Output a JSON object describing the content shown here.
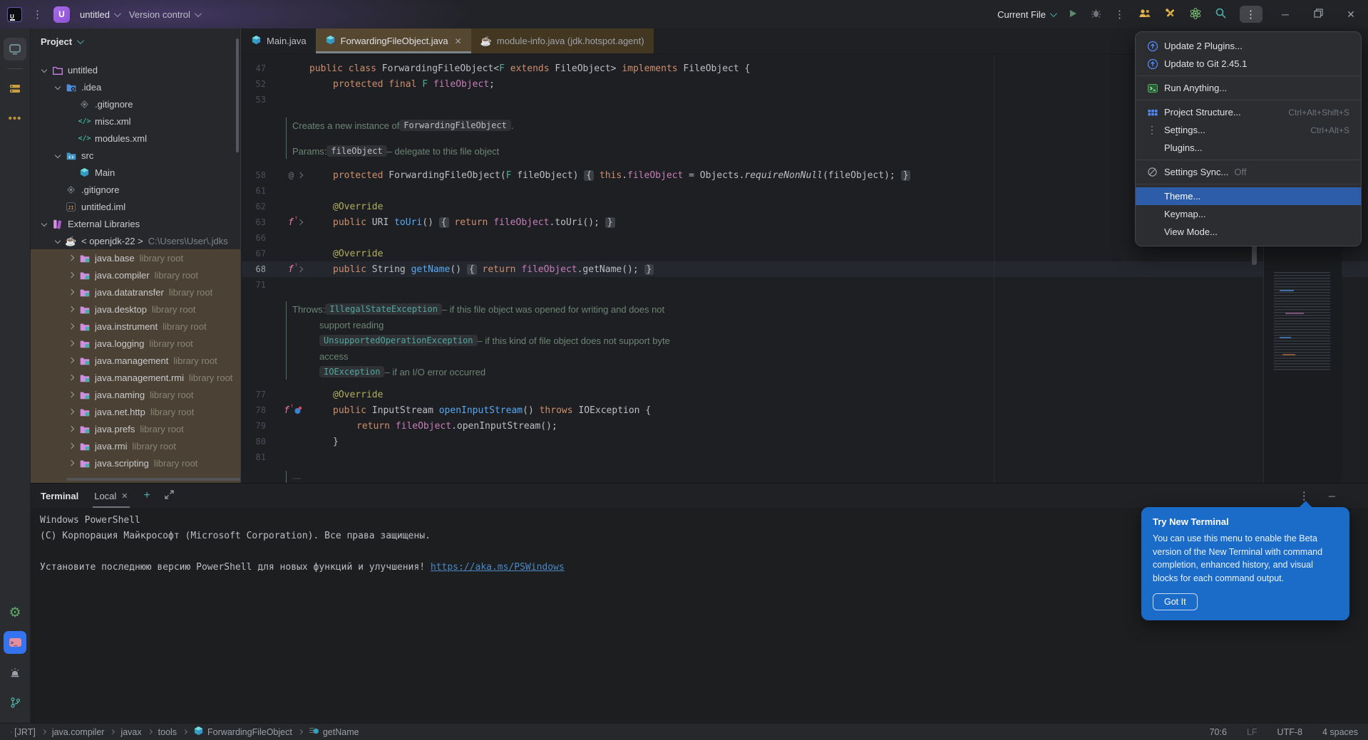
{
  "title_bar": {
    "project_name": "untitled",
    "vcs_widget": "Version control",
    "run_widget": "Current File"
  },
  "project_panel": {
    "header": "Project",
    "tree": [
      {
        "label": "untitled",
        "icon": "folderP",
        "lvl": 0,
        "ch": "v"
      },
      {
        "label": ".idea",
        "icon": "folderIdea",
        "lvl": 1,
        "ch": "v"
      },
      {
        "label": ".gitignore",
        "icon": "gitf",
        "lvl": 2
      },
      {
        "label": "misc.xml",
        "icon": "xml",
        "lvl": 2
      },
      {
        "label": "modules.xml",
        "icon": "xml",
        "lvl": 2
      },
      {
        "label": "src",
        "icon": "folderSrc",
        "lvl": 1,
        "ch": "v"
      },
      {
        "label": "Main",
        "icon": "cls",
        "lvl": 2
      },
      {
        "label": ".gitignore",
        "icon": "gitf",
        "lvl": 1
      },
      {
        "label": "untitled.iml",
        "icon": "iml",
        "lvl": 1
      },
      {
        "label": "External Libraries",
        "icon": "lib",
        "lvl": 0,
        "ch": "v"
      },
      {
        "label": "< openjdk-22 >",
        "meta": "C:\\Users\\User\\.jdks",
        "icon": "cup",
        "lvl": 1,
        "ch": "v"
      },
      {
        "label": "java.base",
        "meta": "library root",
        "icon": "modf",
        "lvl": 2,
        "ch": "r",
        "lib": 1
      },
      {
        "label": "java.compiler",
        "meta": "library root",
        "icon": "modf",
        "lvl": 2,
        "ch": "r",
        "lib": 1
      },
      {
        "label": "java.datatransfer",
        "meta": "library root",
        "icon": "modf",
        "lvl": 2,
        "ch": "r",
        "lib": 1
      },
      {
        "label": "java.desktop",
        "meta": "library root",
        "icon": "modf",
        "lvl": 2,
        "ch": "r",
        "lib": 1
      },
      {
        "label": "java.instrument",
        "meta": "library root",
        "icon": "modf",
        "lvl": 2,
        "ch": "r",
        "lib": 1
      },
      {
        "label": "java.logging",
        "meta": "library root",
        "icon": "modf",
        "lvl": 2,
        "ch": "r",
        "lib": 1
      },
      {
        "label": "java.management",
        "meta": "library root",
        "icon": "modf",
        "lvl": 2,
        "ch": "r",
        "lib": 1
      },
      {
        "label": "java.management.rmi",
        "meta": "library root",
        "icon": "modf",
        "lvl": 2,
        "ch": "r",
        "lib": 1
      },
      {
        "label": "java.naming",
        "meta": "library root",
        "icon": "modf",
        "lvl": 2,
        "ch": "r",
        "lib": 1
      },
      {
        "label": "java.net.http",
        "meta": "library root",
        "icon": "modf",
        "lvl": 2,
        "ch": "r",
        "lib": 1
      },
      {
        "label": "java.prefs",
        "meta": "library root",
        "icon": "modf",
        "lvl": 2,
        "ch": "r",
        "lib": 1
      },
      {
        "label": "java.rmi",
        "meta": "library root",
        "icon": "modf",
        "lvl": 2,
        "ch": "r",
        "lib": 1
      },
      {
        "label": "java.scripting",
        "meta": "library root",
        "icon": "modf",
        "lvl": 2,
        "ch": "r",
        "lib": 1
      }
    ]
  },
  "editor": {
    "tabs": [
      {
        "label": "Main.java",
        "icon": "cls"
      },
      {
        "label": "ForwardingFileObject.java",
        "icon": "cls",
        "active": 1,
        "close": 1
      },
      {
        "label": "module-info.java (jdk.hotspot.agent)",
        "icon": "cup",
        "warm": 1
      }
    ],
    "rows": [
      {
        "t": "c",
        "n": "47",
        "i": 0,
        "segs": [
          [
            "kw",
            "public class "
          ],
          [
            "pln",
            "ForwardingFileObject<"
          ],
          [
            "tp",
            "F"
          ],
          [
            "kw",
            " extends "
          ],
          [
            "pln",
            "FileObject> "
          ],
          [
            "kw",
            "implements "
          ],
          [
            "pln",
            "FileObject {"
          ]
        ]
      },
      {
        "t": "c",
        "n": "52",
        "i": 1,
        "segs": [
          [
            "kw",
            "protected final "
          ],
          [
            "tp",
            "F"
          ],
          [
            "pln",
            " "
          ],
          [
            "fld",
            "fileObject"
          ],
          [
            "pln",
            ";"
          ]
        ]
      },
      {
        "t": "c",
        "n": "53",
        "segs": []
      },
      {
        "t": "s",
        "h": 14
      },
      {
        "t": "d",
        "dl": 1,
        "segs": [
          [
            "doc",
            "Creates a new instance of "
          ],
          [
            "chip",
            "ForwardingFileObject"
          ],
          [
            "doc",
            " ."
          ]
        ]
      },
      {
        "t": "s",
        "h": 14,
        "dl": 1
      },
      {
        "t": "d",
        "dl": 1,
        "segs": [
          [
            "doc",
            "Params:  "
          ],
          [
            "chip",
            "fileObject"
          ],
          [
            "doc",
            "  – delegate to this file object"
          ]
        ]
      },
      {
        "t": "s",
        "h": 12
      },
      {
        "t": "c",
        "n": "58",
        "g": [
          "at",
          "fold"
        ],
        "i": 1,
        "segs": [
          [
            "kw",
            "protected "
          ],
          [
            "pln",
            "ForwardingFileObject("
          ],
          [
            "tp",
            "F"
          ],
          [
            "pln",
            " fileObject) "
          ],
          [
            "foldb",
            "{"
          ],
          [
            "pln",
            " "
          ],
          [
            "kw",
            "this"
          ],
          [
            "pln",
            "."
          ],
          [
            "fld",
            "fileObject"
          ],
          [
            "pln",
            " = Objects."
          ],
          [
            "itm",
            "requireNonNull"
          ],
          [
            "pln",
            "(fileObject); "
          ],
          [
            "foldb",
            "}"
          ]
        ]
      },
      {
        "t": "c",
        "n": "61",
        "segs": []
      },
      {
        "t": "c",
        "n": "62",
        "i": 1,
        "segs": [
          [
            "ann",
            "@Override"
          ]
        ]
      },
      {
        "t": "c",
        "n": "63",
        "g": [
          "fx",
          "fold"
        ],
        "i": 1,
        "segs": [
          [
            "kw",
            "public "
          ],
          [
            "pln",
            "URI "
          ],
          [
            "mth",
            "toUri"
          ],
          [
            "pln",
            "() "
          ],
          [
            "foldb",
            "{"
          ],
          [
            "kw",
            " return "
          ],
          [
            "fld",
            "fileObject"
          ],
          [
            "pln",
            ".toUri(); "
          ],
          [
            "foldb",
            "}"
          ]
        ]
      },
      {
        "t": "c",
        "n": "66",
        "segs": []
      },
      {
        "t": "c",
        "n": "67",
        "i": 1,
        "segs": [
          [
            "ann",
            "@Override"
          ]
        ]
      },
      {
        "t": "c",
        "n": "68",
        "hl": 1,
        "g": [
          "fx",
          "fold"
        ],
        "i": 1,
        "segs": [
          [
            "kw",
            "public "
          ],
          [
            "pln",
            "String "
          ],
          [
            "mth",
            "getName"
          ],
          [
            "pln",
            "() "
          ],
          [
            "foldb",
            "{"
          ],
          [
            "kw",
            " return "
          ],
          [
            "fld",
            "fileObject"
          ],
          [
            "pln",
            ".getName(); "
          ],
          [
            "foldb",
            "}"
          ]
        ]
      },
      {
        "t": "c",
        "n": "71",
        "segs": []
      },
      {
        "t": "s",
        "h": 12
      },
      {
        "t": "d",
        "dl": 1,
        "segs": [
          [
            "doc",
            "Throws:  "
          ],
          [
            "chipt",
            "IllegalStateException"
          ],
          [
            "doc",
            "  – if this file object was opened for writing and does not"
          ]
        ]
      },
      {
        "t": "d",
        "dl": 1,
        "di": 1,
        "segs": [
          [
            "doc",
            "support reading"
          ]
        ]
      },
      {
        "t": "d",
        "dl": 1,
        "di": 1,
        "segs": [
          [
            "chipt",
            "UnsupportedOperationException"
          ],
          [
            "doc",
            "  – if this kind of file object does not support byte"
          ]
        ]
      },
      {
        "t": "d",
        "dl": 1,
        "di": 1,
        "segs": [
          [
            "doc",
            "access"
          ]
        ]
      },
      {
        "t": "d",
        "dl": 1,
        "di": 1,
        "segs": [
          [
            "chipt",
            "IOException"
          ],
          [
            "doc",
            "  – if an I/O error occurred"
          ]
        ]
      },
      {
        "t": "s",
        "h": 10
      },
      {
        "t": "c",
        "n": "77",
        "i": 1,
        "segs": [
          [
            "ann",
            "@Override"
          ]
        ]
      },
      {
        "t": "c",
        "n": "78",
        "g": [
          "fx",
          "impl"
        ],
        "i": 1,
        "segs": [
          [
            "kw",
            "public "
          ],
          [
            "pln",
            "InputStream "
          ],
          [
            "mth",
            "openInputStream"
          ],
          [
            "pln",
            "() "
          ],
          [
            "kw",
            "throws"
          ],
          [
            "pln",
            " IOException {"
          ]
        ]
      },
      {
        "t": "c",
        "n": "79",
        "i": 2,
        "segs": [
          [
            "kw",
            "return "
          ],
          [
            "fld",
            "fileObject"
          ],
          [
            "pln",
            ".openInputStream();"
          ]
        ]
      },
      {
        "t": "c",
        "n": "80",
        "i": 1,
        "segs": [
          [
            "pln",
            "}"
          ]
        ]
      },
      {
        "t": "c",
        "n": "81",
        "segs": []
      },
      {
        "t": "s",
        "h": 8
      },
      {
        "t": "d",
        "dl": 1,
        "segs": [
          [
            "chip",
            "   "
          ]
        ]
      }
    ]
  },
  "menu": {
    "items": [
      {
        "icon": "upd",
        "label": "Update 2 Plugins..."
      },
      {
        "icon": "upd",
        "label": "Update to Git 2.45.1"
      },
      {
        "div": 1
      },
      {
        "icon": "runa",
        "label": "Run Anything..."
      },
      {
        "div": 1
      },
      {
        "icon": "pstruct",
        "label": "Project Structure...",
        "shortcut": "Ctrl+Alt+Shift+S"
      },
      {
        "icon": "kebab",
        "label": "Settings...",
        "mnemonic": "t",
        "shortcut": "Ctrl+Alt+S"
      },
      {
        "label": "Plugins..."
      },
      {
        "div": 1
      },
      {
        "icon": "synco",
        "label": "Settings Sync...",
        "suffix": "Off"
      },
      {
        "div": 1
      },
      {
        "label": "Theme...",
        "selected": 1
      },
      {
        "label": "Keymap..."
      },
      {
        "label": "View Mode..."
      }
    ]
  },
  "terminal": {
    "title": "Terminal",
    "tab": "Local",
    "lines": [
      "Windows PowerShell",
      "(C) Корпорация Майкрософт (Microsoft Corporation). Все права защищены.",
      "",
      {
        "text": "Установите последнюю версию PowerShell для новых функций и улучшения! ",
        "link": "https://aka.ms/PSWindows"
      }
    ]
  },
  "popup": {
    "title": "Try New Terminal",
    "body": "You can use this menu to enable the Beta version of the New Terminal with command completion, enhanced history, and visual blocks for each command output.",
    "button": "Got It"
  },
  "status_bar": {
    "breadcrumbs": [
      {
        "label": "[JRT]"
      },
      {
        "label": "java.compiler"
      },
      {
        "label": "javax"
      },
      {
        "label": "tools"
      },
      {
        "label": "ForwardingFileObject",
        "icon": "cls"
      },
      {
        "label": "getName",
        "icon": "mth"
      }
    ],
    "right": [
      {
        "label": "70:6"
      },
      {
        "label": "LF",
        "dim": 1
      },
      {
        "label": "UTF-8"
      },
      {
        "label": "4 spaces"
      }
    ]
  }
}
